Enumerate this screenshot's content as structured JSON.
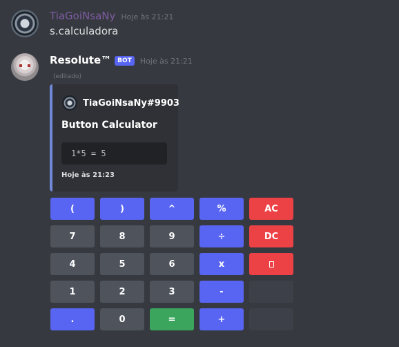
{
  "messages": [
    {
      "author": "TiaGoiNsaNy",
      "timestamp": "Hoje às 21:21",
      "content": "s.calculadora"
    },
    {
      "author": "Resolute™",
      "badge": "BOT",
      "timestamp": "Hoje às 21:21",
      "edited": "(editado)",
      "embed": {
        "author": "TiaGoiNsaNy#9903",
        "title": "Button Calculator",
        "code": "1*5 = 5",
        "footer": "Hoje às 21:23",
        "accent_color": "#7289da"
      }
    }
  ],
  "calculator": {
    "rows": [
      [
        {
          "label": "(",
          "style": "blurple"
        },
        {
          "label": ")",
          "style": "blurple"
        },
        {
          "label": "^",
          "style": "blurple"
        },
        {
          "label": "%",
          "style": "blurple"
        },
        {
          "label": "AC",
          "style": "red"
        }
      ],
      [
        {
          "label": "7",
          "style": "grey"
        },
        {
          "label": "8",
          "style": "grey"
        },
        {
          "label": "9",
          "style": "grey"
        },
        {
          "label": "÷",
          "style": "blurple"
        },
        {
          "label": "DC",
          "style": "red"
        }
      ],
      [
        {
          "label": "4",
          "style": "grey"
        },
        {
          "label": "5",
          "style": "grey"
        },
        {
          "label": "6",
          "style": "grey"
        },
        {
          "label": "x",
          "style": "blurple"
        },
        {
          "label": "",
          "style": "red",
          "icon": "backspace-icon"
        }
      ],
      [
        {
          "label": "1",
          "style": "grey"
        },
        {
          "label": "2",
          "style": "grey"
        },
        {
          "label": "3",
          "style": "grey"
        },
        {
          "label": "-",
          "style": "blurple"
        },
        {
          "label": "",
          "style": "empty"
        }
      ],
      [
        {
          "label": ".",
          "style": "blurple"
        },
        {
          "label": "0",
          "style": "grey"
        },
        {
          "label": "=",
          "style": "green"
        },
        {
          "label": "+",
          "style": "blurple"
        },
        {
          "label": "",
          "style": "empty"
        }
      ]
    ]
  }
}
